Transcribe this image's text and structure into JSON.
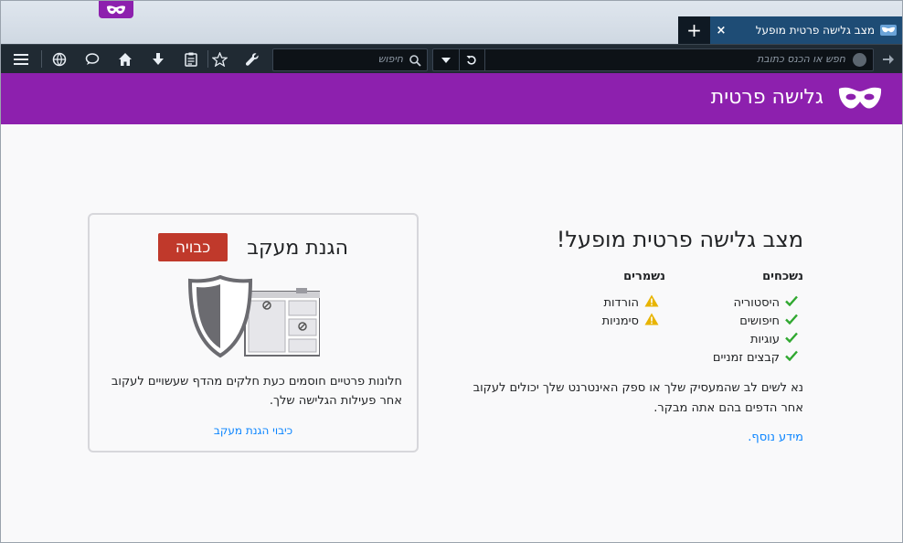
{
  "browser": {
    "tab": {
      "title": "מצב גלישה פרטית מופעל",
      "close": "×",
      "new_tab": "+"
    },
    "urlbar": {
      "placeholder": "חפש או הכנס כתובת"
    },
    "searchbar": {
      "placeholder": "חיפוש"
    }
  },
  "header": {
    "title": "גלישה פרטית"
  },
  "main": {
    "title": "מצב גלישה פרטית מופעל!",
    "not_saved": {
      "heading": "נשכחים",
      "items": [
        "היסטוריה",
        "חיפושים",
        "עוגיות",
        "קבצים זמניים"
      ]
    },
    "saved": {
      "heading": "נשמרים",
      "items": [
        "הורדות",
        "סימניות"
      ]
    },
    "note": "נא לשים לב שהמעסיק שלך או ספק האינטרנט שלך יכולים לעקוב אחר הדפים בהם אתה מבקר.",
    "learn_more": "מידע נוסף."
  },
  "tracking": {
    "title": "הגנת מעקב",
    "status": "כבויה",
    "description": "חלונות פרטיים חוסמים כעת חלקים מהדף שעשויים לעקוב אחר פעילות הגלישה שלך.",
    "link": "כיבוי הגנת מעקב"
  },
  "colors": {
    "accent": "#8d20ae",
    "link": "#0a84ff",
    "badge": "#c0392b",
    "check": "#30a830",
    "warn": "#e8b400"
  },
  "icons": [
    "mask-icon",
    "forward-icon",
    "reload-icon",
    "dropdown-icon",
    "search-icon",
    "bookmark-star-icon",
    "reading-list-icon",
    "download-icon",
    "home-icon",
    "chat-icon",
    "globe-icon",
    "wrench-icon",
    "menu-icon",
    "check-icon",
    "warning-icon",
    "shield-icon"
  ]
}
